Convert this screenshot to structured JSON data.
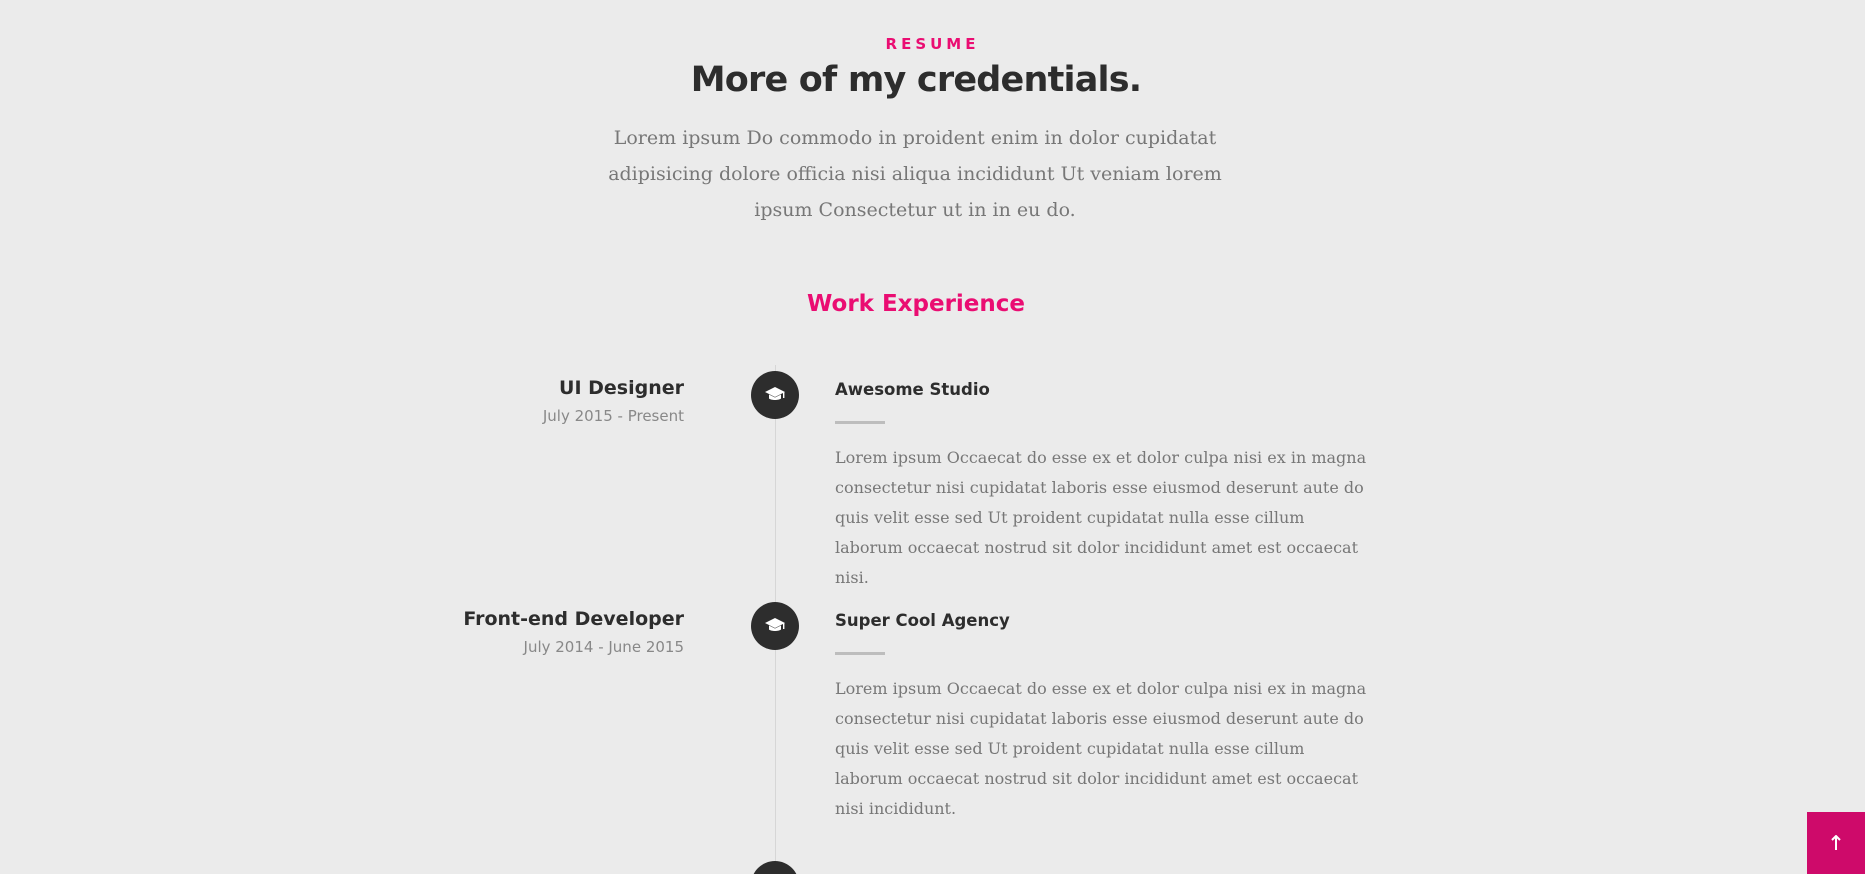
{
  "resume": {
    "eyebrow": "RESUME",
    "title": "More of my credentials.",
    "lead": "Lorem ipsum Do commodo in proident enim in dolor cupidatat adipisicing dolore officia nisi aliqua incididunt Ut veniam lorem ipsum Consectetur ut in in eu do."
  },
  "work": {
    "heading": "Work Experience",
    "items": [
      {
        "title": "UI Designer",
        "date": "July 2015 - Present",
        "company": "Awesome Studio",
        "icon": "graduation-cap-icon",
        "description": "Lorem ipsum Occaecat do esse ex et dolor culpa nisi ex in magna consectetur nisi cupidatat laboris esse eiusmod deserunt aute do quis velit esse sed Ut proident cupidatat nulla esse cillum laborum occaecat nostrud sit dolor incididunt amet est occaecat nisi."
      },
      {
        "title": "Front-end Developer",
        "date": "July 2014 - June 2015",
        "company": "Super Cool Agency",
        "icon": "graduation-cap-icon",
        "description": "Lorem ipsum Occaecat do esse ex et dolor culpa nisi ex in magna consectetur nisi cupidatat laboris esse eiusmod deserunt aute do quis velit esse sed Ut proident cupidatat nulla esse cillum laborum occaecat nostrud sit dolor incididunt amet est occaecat nisi incididunt."
      }
    ]
  },
  "back_to_top": {
    "icon": "arrow-up-icon"
  },
  "colors": {
    "accent": "#ea0d72",
    "background": "#ebebeb",
    "dark": "#2d2d2d",
    "muted_text": "#777777",
    "back_to_top": "#ce0a6a"
  }
}
